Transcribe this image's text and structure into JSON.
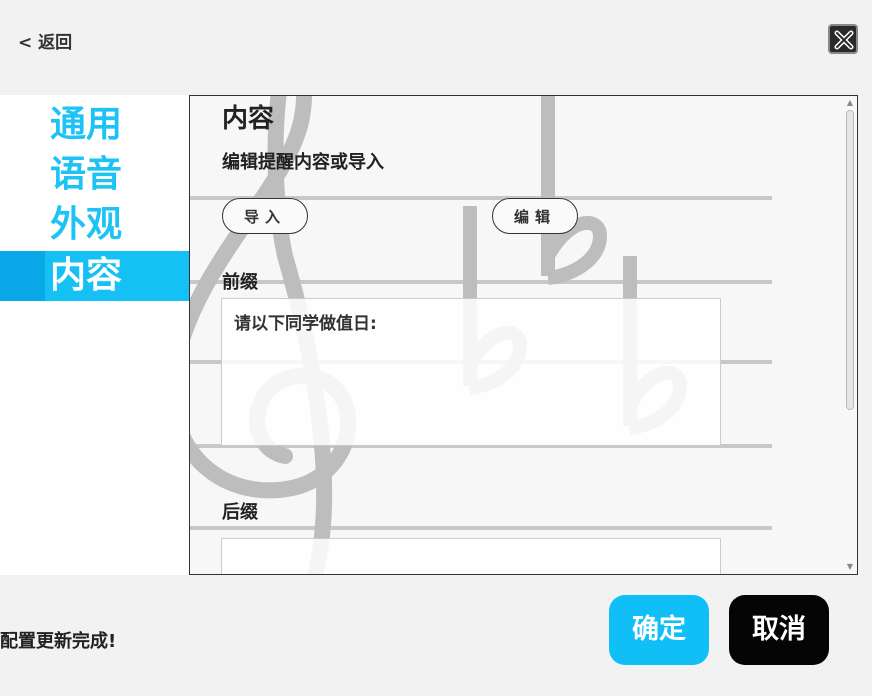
{
  "header": {
    "back_label": "< 返回",
    "close_icon": "close-icon"
  },
  "sidebar": {
    "items": [
      {
        "label": "通用",
        "active": false
      },
      {
        "label": "语音",
        "active": false
      },
      {
        "label": "外观",
        "active": false
      },
      {
        "label": "内容",
        "active": true
      }
    ]
  },
  "content": {
    "title": "内容",
    "subtitle": "编辑提醒内容或导入",
    "import_label": "导入",
    "edit_label": "编辑",
    "prefix_label": "前缀",
    "prefix_value": "请以下同学做值日:",
    "suffix_label": "后缀",
    "suffix_value": ""
  },
  "footer": {
    "status": "配置更新完成!",
    "confirm_label": "确定",
    "cancel_label": "取消"
  },
  "colors": {
    "accent": "#15c0f5",
    "nav_text": "#1ec3f5",
    "cancel": "#050505"
  }
}
